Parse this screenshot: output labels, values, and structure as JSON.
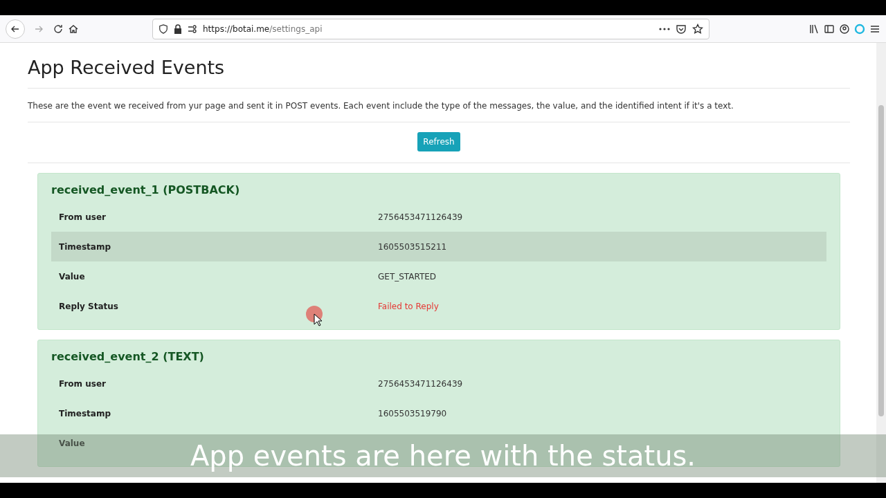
{
  "browser": {
    "url_host": "https://botai.me",
    "url_path": "/settings_api"
  },
  "page": {
    "title": "App Received Events",
    "description": "These are the event we received from yur page and sent it in POST events. Each event include the type of the messages, the value, and the identified intent if it's a text.",
    "refresh_button": "Refresh"
  },
  "events": [
    {
      "title": "received_event_1 (POSTBACK)",
      "rows": [
        {
          "label": "From user",
          "value": "2756453471126439",
          "kind": "text",
          "highlighted": false
        },
        {
          "label": "Timestamp",
          "value": "1605503515211",
          "kind": "text",
          "highlighted": true
        },
        {
          "label": "Value",
          "value": "GET_STARTED",
          "kind": "text",
          "highlighted": false
        },
        {
          "label": "Reply Status",
          "value": "Failed to Reply",
          "kind": "error",
          "highlighted": false
        }
      ]
    },
    {
      "title": "received_event_2 (TEXT)",
      "rows": [
        {
          "label": "From user",
          "value": "2756453471126439",
          "kind": "text",
          "highlighted": false
        },
        {
          "label": "Timestamp",
          "value": "1605503519790",
          "kind": "text",
          "highlighted": false
        },
        {
          "label": "Value",
          "highlighted": false
        }
      ]
    }
  ],
  "caption": "App events are here with the status."
}
